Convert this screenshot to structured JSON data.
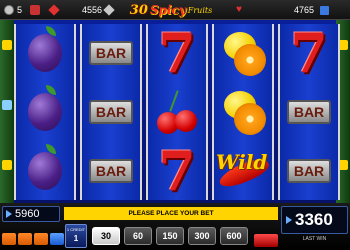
{
  "topbar": {
    "chips": "5",
    "lines": "",
    "cash": "4556",
    "heart_amount": "4765",
    "gift": ""
  },
  "logo": {
    "number": "30",
    "word": "Spicy",
    "subword": "Fruits"
  },
  "reels": [
    [
      "plum",
      "plum",
      "plum"
    ],
    [
      "bar",
      "bar",
      "bar"
    ],
    [
      "seven",
      "cherry",
      "seven"
    ],
    [
      "lemon-orange",
      "lemon-orange",
      "wild"
    ],
    [
      "seven",
      "bar",
      "bar"
    ]
  ],
  "symbols": {
    "bar_label": "BAR",
    "seven_label": "7",
    "wild_label": "Wild"
  },
  "bottom": {
    "balance": "5960",
    "status_message": "PLEASE PLACE YOUR BET",
    "credit_label": "1 CREDIT",
    "credit_value": "1",
    "bets": [
      "30",
      "60",
      "150",
      "300",
      "600"
    ],
    "active_bet_index": 0,
    "last_win": "3360",
    "last_win_label": "LAST WIN"
  },
  "colors": {
    "accent": "#ffd400",
    "reel_bg": "#0b2aa8",
    "seven": "#e01e1e"
  }
}
